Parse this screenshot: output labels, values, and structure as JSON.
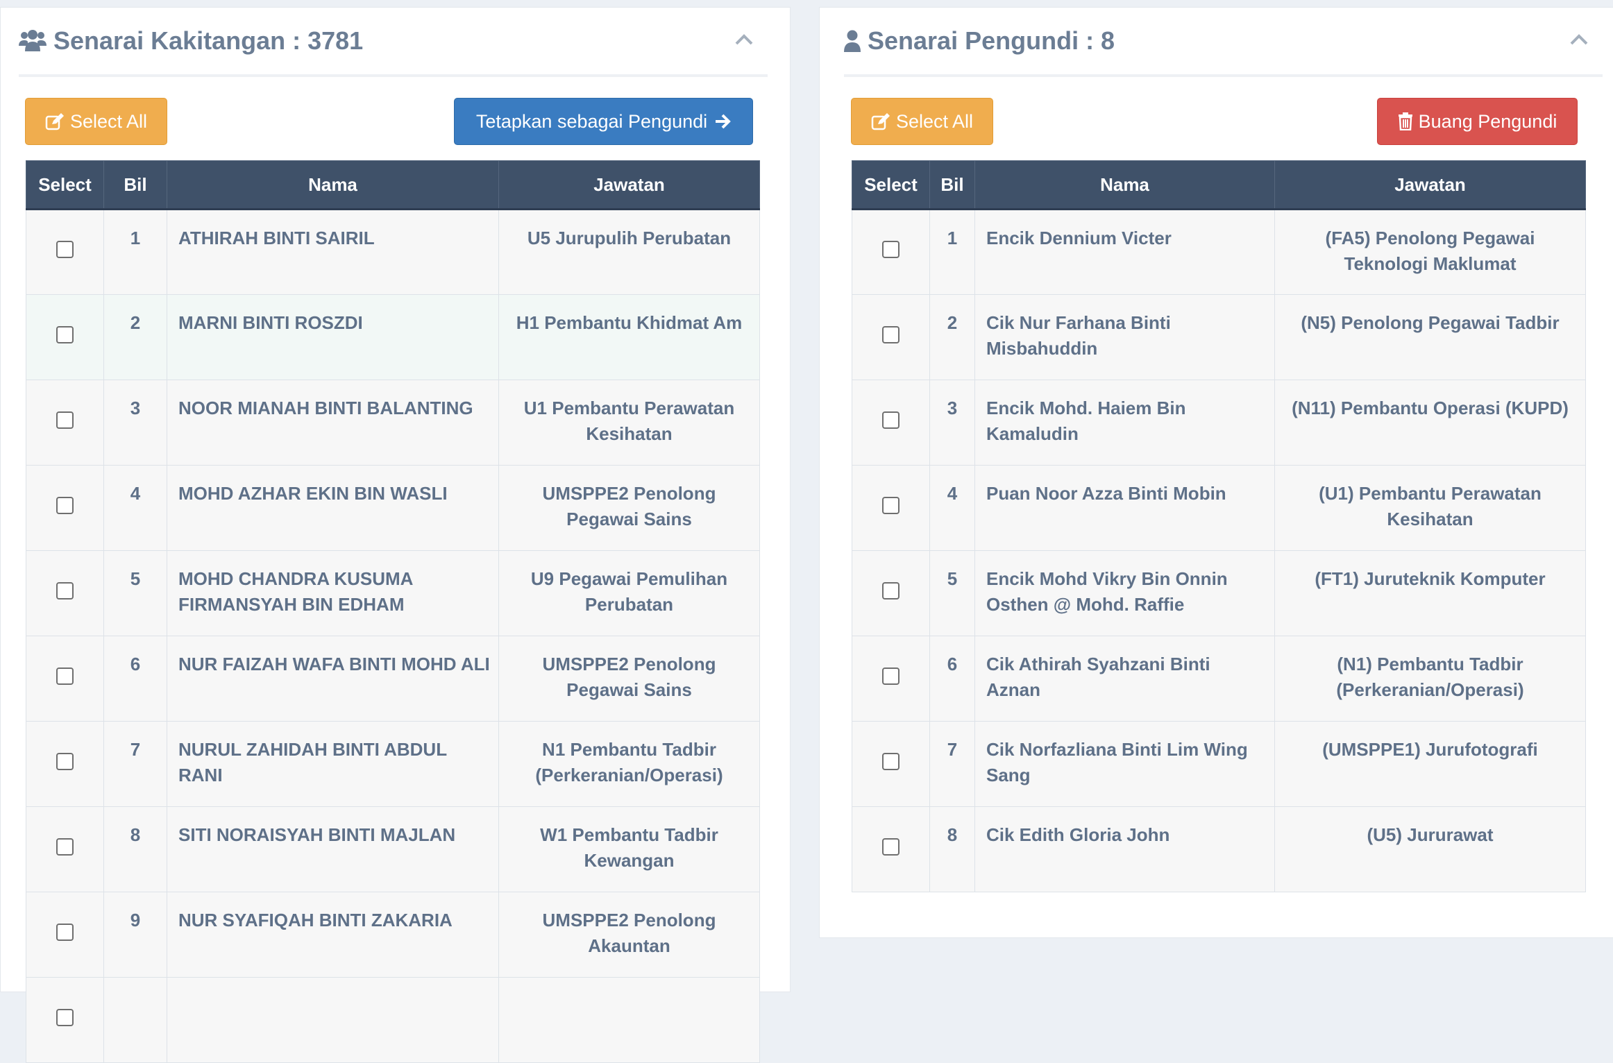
{
  "left_panel": {
    "title": "Senarai Kakitangan : 3781",
    "select_all_label": "Select All",
    "assign_label": "Tetapkan sebagai Pengundi",
    "columns": [
      "Select",
      "Bil",
      "Nama",
      "Jawatan"
    ],
    "rows": [
      {
        "bil": "1",
        "nama": "ATHIRAH BINTI SAIRIL",
        "jawatan": "U5 Jurupulih Perubatan"
      },
      {
        "bil": "2",
        "nama": "MARNI BINTI ROSZDI",
        "jawatan": "H1 Pembantu Khidmat Am"
      },
      {
        "bil": "3",
        "nama": "NOOR MIANAH BINTI BALANTING",
        "jawatan": "U1 Pembantu Perawatan Kesihatan"
      },
      {
        "bil": "4",
        "nama": "MOHD AZHAR EKIN BIN WASLI",
        "jawatan": "UMSPPE2 Penolong Pegawai Sains"
      },
      {
        "bil": "5",
        "nama": "MOHD CHANDRA KUSUMA FIRMANSYAH BIN EDHAM",
        "jawatan": "U9 Pegawai Pemulihan Perubatan"
      },
      {
        "bil": "6",
        "nama": "NUR FAIZAH WAFA BINTI MOHD ALI",
        "jawatan": "UMSPPE2 Penolong Pegawai Sains"
      },
      {
        "bil": "7",
        "nama": "NURUL ZAHIDAH BINTI ABDUL RANI",
        "jawatan": "N1 Pembantu Tadbir (Perkeranian/Operasi)"
      },
      {
        "bil": "8",
        "nama": "SITI NORAISYAH BINTI MAJLAN",
        "jawatan": "W1 Pembantu Tadbir Kewangan"
      },
      {
        "bil": "9",
        "nama": "NUR SYAFIQAH BINTI ZAKARIA",
        "jawatan": "UMSPPE2 Penolong Akauntan"
      },
      {
        "bil": "",
        "nama": "",
        "jawatan": ""
      }
    ]
  },
  "right_panel": {
    "title": "Senarai Pengundi : 8",
    "select_all_label": "Select All",
    "remove_label": "Buang Pengundi",
    "columns": [
      "Select",
      "Bil",
      "Nama",
      "Jawatan"
    ],
    "rows": [
      {
        "bil": "1",
        "nama": "Encik Dennium Victer",
        "jawatan": "(FA5) Penolong Pegawai Teknologi Maklumat"
      },
      {
        "bil": "2",
        "nama": "Cik Nur Farhana Binti Misbahuddin",
        "jawatan": "(N5) Penolong Pegawai Tadbir"
      },
      {
        "bil": "3",
        "nama": "Encik Mohd. Haiem Bin Kamaludin",
        "jawatan": "(N11) Pembantu Operasi (KUPD)"
      },
      {
        "bil": "4",
        "nama": "Puan Noor Azza Binti Mobin",
        "jawatan": "(U1) Pembantu Perawatan Kesihatan"
      },
      {
        "bil": "5",
        "nama": "Encik Mohd Vikry Bin Onnin Osthen @ Mohd. Raffie",
        "jawatan": "(FT1) Juruteknik Komputer"
      },
      {
        "bil": "6",
        "nama": "Cik Athirah Syahzani Binti Aznan",
        "jawatan": "(N1) Pembantu Tadbir (Perkeranian/Operasi)"
      },
      {
        "bil": "7",
        "nama": "Cik Norfazliana Binti Lim Wing Sang",
        "jawatan": "(UMSPPE1) Jurufotografi"
      },
      {
        "bil": "8",
        "nama": "Cik Edith Gloria John",
        "jawatan": "(U5) Jururawat"
      }
    ]
  },
  "colors": {
    "header_bg": "#3f5169",
    "warning": "#f0ad4e",
    "primary": "#3a7cc1",
    "danger": "#d9534f",
    "title_text": "#6b7d94"
  },
  "icons": {
    "left_title": "users-icon",
    "right_title": "user-icon",
    "select_all": "edit-icon",
    "assign": "arrow-right-icon",
    "remove": "trash-icon",
    "collapse": "chevron-up-icon"
  }
}
